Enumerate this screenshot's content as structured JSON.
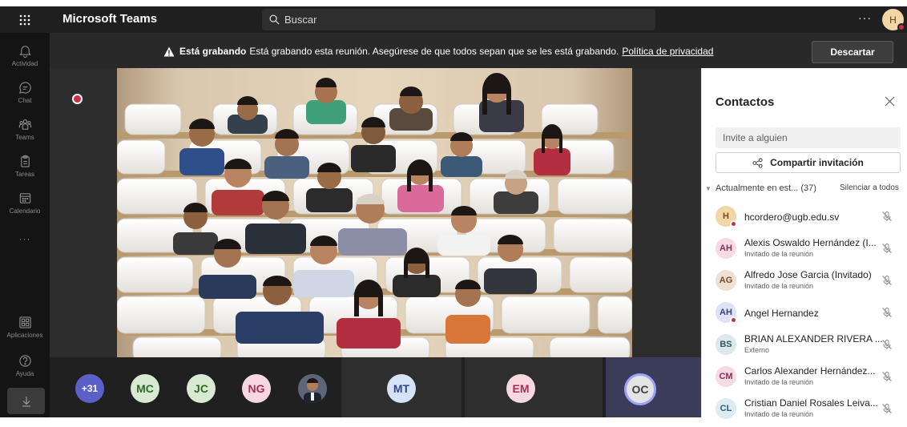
{
  "app": {
    "title": "Microsoft Teams"
  },
  "search": {
    "placeholder": "Buscar"
  },
  "topbar": {
    "more_label": "···",
    "avatar_initial": "H"
  },
  "rail": {
    "items": [
      {
        "label": "Actividad",
        "icon": "bell-icon"
      },
      {
        "label": "Chat",
        "icon": "chat-icon"
      },
      {
        "label": "Teams",
        "icon": "teams-icon"
      },
      {
        "label": "Tareas",
        "icon": "tasks-icon"
      },
      {
        "label": "Calendario",
        "icon": "calendar-icon"
      }
    ],
    "more": "···",
    "bottom": [
      {
        "label": "Aplicaciones",
        "icon": "apps-icon"
      },
      {
        "label": "Ayuda",
        "icon": "help-icon"
      }
    ]
  },
  "banner": {
    "bold": "Está grabando",
    "message": "Está grabando esta reunión. Asegúrese de que todos sepan que se les está grabando.",
    "link": "Política de privacidad",
    "dismiss": "Descartar"
  },
  "roster": {
    "overflow_count": "+31",
    "bubbles": [
      {
        "initials": "MC",
        "bg": "#d8ead1",
        "fg": "#2f6a25"
      },
      {
        "initials": "JC",
        "bg": "#d8ead1",
        "fg": "#2f6a25"
      },
      {
        "initials": "NG",
        "bg": "#f8d7e1",
        "fg": "#a2315a"
      },
      {
        "initials": "MT",
        "bg": "#d6e2f6",
        "fg": "#2c4a85"
      },
      {
        "initials": "EM",
        "bg": "#f8d7e1",
        "fg": "#a2315a"
      },
      {
        "initials": "OC",
        "bg": "#e4e4e4",
        "fg": "#424242"
      }
    ]
  },
  "panel": {
    "title": "Contactos",
    "invite_placeholder": "Invite a alguien",
    "share_label": "Compartir invitación",
    "section_label": "Actualmente en est... (37)",
    "mute_all": "Silenciar a todos",
    "participants": [
      {
        "initials": "H",
        "name": "hcordero@ugb.edu.sv",
        "role": "",
        "bg": "#f3d6a6",
        "fg": "#7a4a12",
        "status": true
      },
      {
        "initials": "AH",
        "name": "Alexis Oswaldo Hernández (I...",
        "role": "Invitado de la reunión",
        "bg": "#f4dbe6",
        "fg": "#8a2d5a",
        "status": false
      },
      {
        "initials": "AG",
        "name": "Alfredo Jose Garcia (Invitado)",
        "role": "Invitado de la reunión",
        "bg": "#efe0d4",
        "fg": "#7a4a2a",
        "status": false
      },
      {
        "initials": "AH",
        "name": "Angel Hernandez",
        "role": "",
        "bg": "#dde3f4",
        "fg": "#35457a",
        "status": true
      },
      {
        "initials": "BS",
        "name": "BRIAN ALEXANDER RIVERA ...",
        "role": "Externo",
        "bg": "#dce8ec",
        "fg": "#2e5865",
        "status": false
      },
      {
        "initials": "CM",
        "name": "Carlos Alexander Hernández...",
        "role": "Invitado de la reunión",
        "bg": "#f4dbe6",
        "fg": "#8a2d5a",
        "status": false
      },
      {
        "initials": "CL",
        "name": "Cristian Daniel Rosales Leiva...",
        "role": "Invitado de la reunión",
        "bg": "#dcecf3",
        "fg": "#2b5b78",
        "status": false
      }
    ]
  },
  "colors": {
    "accent": "#5b5fc7",
    "recording": "#c4314b",
    "topbar": "#1f1f1f",
    "rail": "#141414"
  }
}
